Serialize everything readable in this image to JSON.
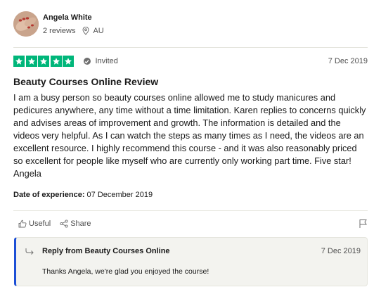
{
  "consumer": {
    "name": "Angela White",
    "reviews": "2 reviews",
    "location": "AU"
  },
  "rating": {
    "stars": 5,
    "max": 5,
    "star_color": "#00b67a"
  },
  "review": {
    "invited_label": "Invited",
    "date": "7 Dec 2019",
    "title": "Beauty Courses Online Review",
    "body": "I am a busy person so beauty courses online allowed me to study manicures and pedicures anywhere, any time without a time limitation. Karen replies to concerns quickly and advises areas of improvement and growth. The information is detailed and the videos very helpful. As I can watch the steps as many times as I need, the videos are an excellent resource. I highly recommend this course - and it was also reasonably priced so excellent for people like myself who are currently only working part time. Five star! Angela",
    "experience_label": "Date of experience:",
    "experience_date": "07 December 2019"
  },
  "actions": {
    "useful_label": "Useful",
    "share_label": "Share"
  },
  "reply": {
    "title": "Reply from Beauty Courses Online",
    "date": "7 Dec 2019",
    "text": "Thanks Angela, we're glad you enjoyed the course!",
    "accent_color": "#1c4fd6"
  }
}
